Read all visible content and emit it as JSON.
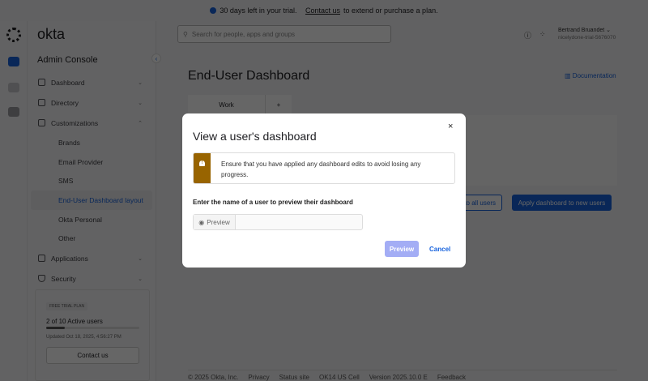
{
  "banner": {
    "text": "30 days left in your trial.",
    "link": "Contact us",
    "suffix": "to extend or purchase a plan."
  },
  "brand": {
    "logo": "okta",
    "console": "Admin Console"
  },
  "search": {
    "placeholder": "Search for people, apps and groups"
  },
  "user": {
    "name": "Bertrand Bruandet",
    "org": "nicelydone-trial-5676070"
  },
  "sidebar": {
    "items": [
      {
        "label": "Dashboard",
        "icon": "home-icon"
      },
      {
        "label": "Directory",
        "icon": "directory-icon"
      },
      {
        "label": "Customizations",
        "icon": "sliders-icon"
      }
    ],
    "sub_items": [
      "Brands",
      "Email Provider",
      "SMS",
      "End-User Dashboard layout",
      "Okta Personal",
      "Other"
    ],
    "items_after": [
      {
        "label": "Applications",
        "icon": "grid-icon"
      },
      {
        "label": "Security",
        "icon": "shield-icon"
      }
    ],
    "trial": {
      "badge": "FREE TRIAL PLAN",
      "users": "2 of 10 Active users",
      "progress": 0.2,
      "updated": "Updated Oct 18, 2025, 4:56:27 PM",
      "contact": "Contact us"
    }
  },
  "main": {
    "title": "End-User Dashboard",
    "documentation": "Documentation",
    "tabs": [
      "Work",
      "+"
    ],
    "apply_all": "to all users",
    "apply_new": "Apply dashboard to new users"
  },
  "footer": [
    "© 2025 Okta, Inc.",
    "Privacy",
    "Status site",
    "OK14 US Cell",
    "Version 2025.10.0 E",
    "Feedback"
  ],
  "modal": {
    "title": "View a user's dashboard",
    "callout": "Ensure that you have applied any dashboard edits to avoid losing any progress.",
    "label": "Enter the name of a user to preview their dashboard",
    "prefix": "Preview",
    "value": "",
    "preview_button": "Preview",
    "cancel_button": "Cancel",
    "close": "×"
  },
  "colors": {
    "accent": "#1662dd",
    "warning": "#986400",
    "disabled": "#a3adf5"
  }
}
